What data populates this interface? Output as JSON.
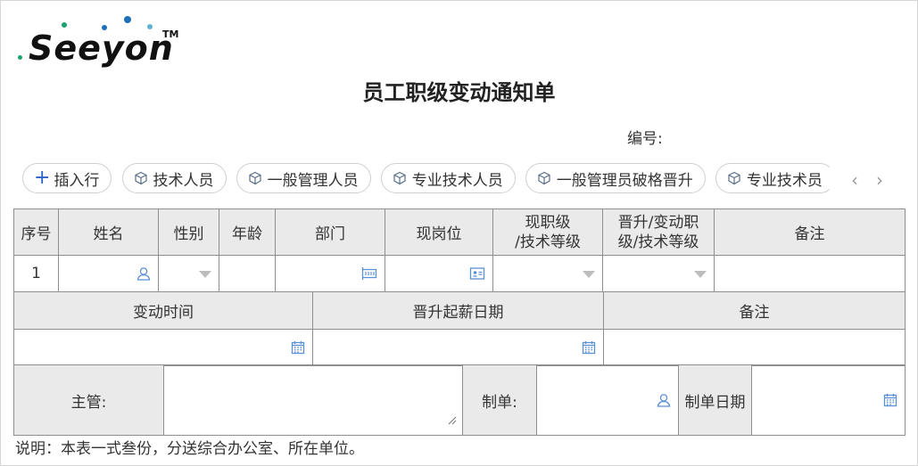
{
  "logo": {
    "text": "Seeyon",
    "tm": "TM"
  },
  "form": {
    "title": "员工职级变动通知单",
    "serial_label": "编号:",
    "note": "说明：本表一式叁份，分送综合办公室、所在单位。"
  },
  "toolbar": {
    "insert_row": "插入行",
    "presets": [
      "技术人员",
      "一般管理人员",
      "专业技术人员",
      "一般管理员破格晋升",
      "专业技术员"
    ]
  },
  "table1": {
    "headers": [
      "序号",
      "姓名",
      "性别",
      "年龄",
      "部门",
      "现岗位",
      "现职级\n/技术等级",
      "晋升/变动职\n级/技术等级",
      "备注"
    ],
    "rows": [
      {
        "index": "1"
      }
    ]
  },
  "table2": {
    "headers": [
      "变动时间",
      "晋升起薪日期",
      "备注"
    ]
  },
  "table3": {
    "supervisor_label": "主管:",
    "maker_label": "制单:",
    "make_date_label": "制单日期"
  },
  "colors": {
    "accent": "#2a62c9",
    "header_bg": "#eaeaea",
    "border": "#8e8e8e"
  }
}
